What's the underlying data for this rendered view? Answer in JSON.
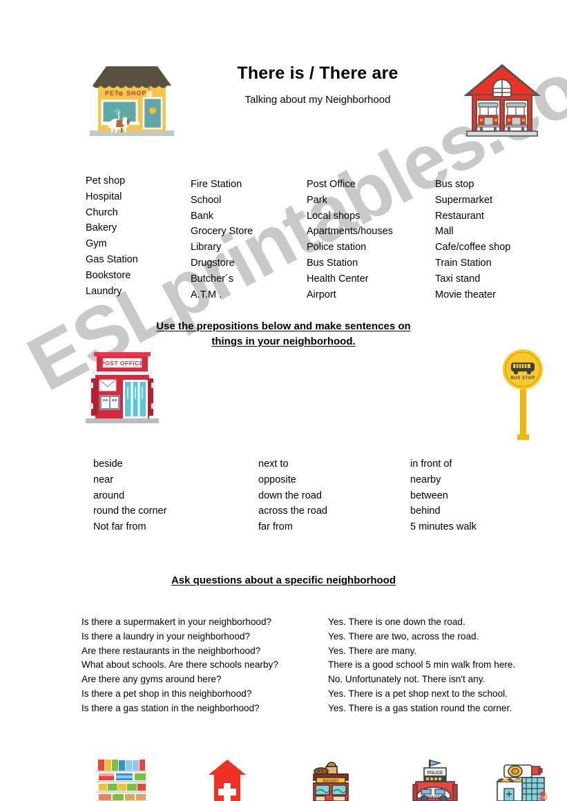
{
  "header": {
    "title": "There is  / There are",
    "subtitle": "Talking about my Neighborhood"
  },
  "illustrations": {
    "pet_shop": {
      "name": "pet-shop-illustration",
      "sign_text": "PET ❁ SHOP"
    },
    "fire_station": {
      "name": "fire-station-illustration"
    },
    "post_office": {
      "name": "post-office-illustration",
      "sign_text": "POST OFFICE"
    },
    "bus_stop_sign": {
      "name": "bus-stop-sign-illustration",
      "sign_text": "BUS STOP"
    }
  },
  "vocabulary": {
    "columns": [
      {
        "items": [
          "Pet shop",
          "Hospital",
          "Church",
          "Bakery",
          "Gym",
          "Gas Station",
          "Bookstore",
          "Laundry"
        ]
      },
      {
        "items": [
          "Fire Station",
          "School",
          "Bank",
          "Grocery Store",
          "Library",
          "Drugstore",
          "Butcher´s",
          "A.T.M ."
        ]
      },
      {
        "items": [
          "Post Office",
          "Park",
          "Local shops",
          "Apartments/houses",
          "Police station",
          "Bus Station",
          "Health Center",
          "Airport"
        ]
      },
      {
        "items": [
          "Bus stop",
          "Supermarket",
          "Restaurant",
          "Mall",
          "Cafe/coffee shop",
          "Train Station",
          "Taxi stand",
          "Movie theater"
        ]
      }
    ]
  },
  "prepositions_heading": {
    "line1": "Use the prepositions below and make sentences on",
    "line2": "things in your neighborhood."
  },
  "prepositions": {
    "columns": [
      {
        "items": [
          "beside",
          "near",
          "around",
          "round the corner",
          "Not far from"
        ]
      },
      {
        "items": [
          "next to",
          "opposite",
          "down the road",
          "across the road",
          "far from"
        ]
      },
      {
        "items": [
          "in front of",
          "nearby",
          "between",
          "behind",
          "5 minutes walk"
        ]
      }
    ]
  },
  "questions_heading": "Ask questions about a specific neighborhood",
  "qa": {
    "questions": [
      "Is there a supermakert in your neighborhood?",
      "Is there a laundry in your neighborhood?",
      "Are there restaurants in the neighborhood?",
      "What about schools. Are there schools nearby?",
      "Are there any gyms around here?",
      "Is there a pet shop in this neighborhood?",
      "Is there a gas station in the neighborhood?"
    ],
    "answers": [
      "Yes. There is one down the road.",
      "Yes. There are two, across the road.",
      "Yes. There are many.",
      "There is a good school 5 min walk from here.",
      "No. Unfortunately not. There isn't any.",
      "Yes. There is a pet shop next to the school.",
      "Yes. There is a gas station round the corner."
    ]
  },
  "bottom_icons": [
    {
      "name": "supermarket-shelves-icon"
    },
    {
      "name": "hospital-icon"
    },
    {
      "name": "bakery-icon"
    },
    {
      "name": "police-station-icon"
    },
    {
      "name": "mall-cinema-icon"
    }
  ],
  "watermark": {
    "text": "ESLprintables.com",
    "color": "#c9c9c9"
  },
  "colors": {
    "red": "#ee3124",
    "yellow": "#f5c242",
    "teal": "#74b6b6",
    "brown": "#57503f",
    "gold": "#f2b705",
    "crimson": "#d6293e"
  }
}
